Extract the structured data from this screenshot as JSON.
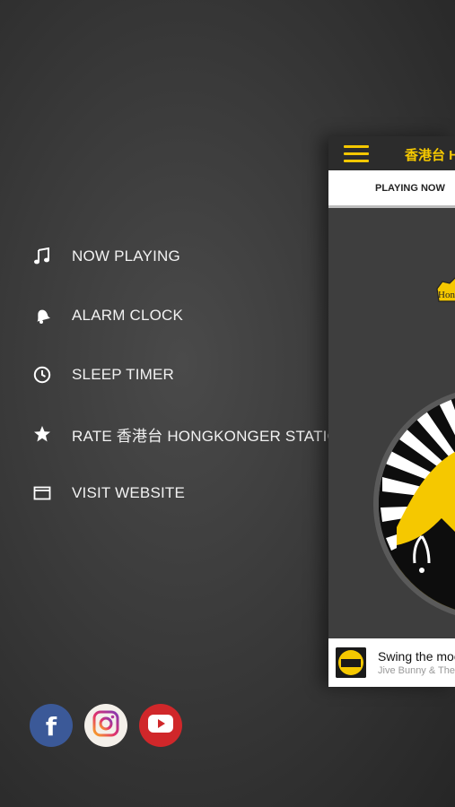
{
  "menu": {
    "items": [
      {
        "label": "NOW PLAYING",
        "icon": "music-note-icon"
      },
      {
        "label": "ALARM CLOCK",
        "icon": "bell-icon"
      },
      {
        "label": "SLEEP TIMER",
        "icon": "clock-icon"
      },
      {
        "label": "RATE 香港台 HONGKONGER STATION",
        "icon": "star-icon"
      },
      {
        "label": "VISIT WEBSITE",
        "icon": "browser-window-icon"
      }
    ]
  },
  "social": [
    {
      "name": "facebook",
      "glyph": "f",
      "color": "#3b5998"
    },
    {
      "name": "instagram",
      "color": "#f4f0ea"
    },
    {
      "name": "youtube",
      "color": "#d0272a"
    }
  ],
  "app": {
    "title": "香港台 H",
    "tab_active": "PLAYING NOW",
    "logo_text": "Hon",
    "now_playing": {
      "title": "Swing the moo",
      "artist": "Jive Bunny & The"
    },
    "accent_color": "#f5c800"
  }
}
